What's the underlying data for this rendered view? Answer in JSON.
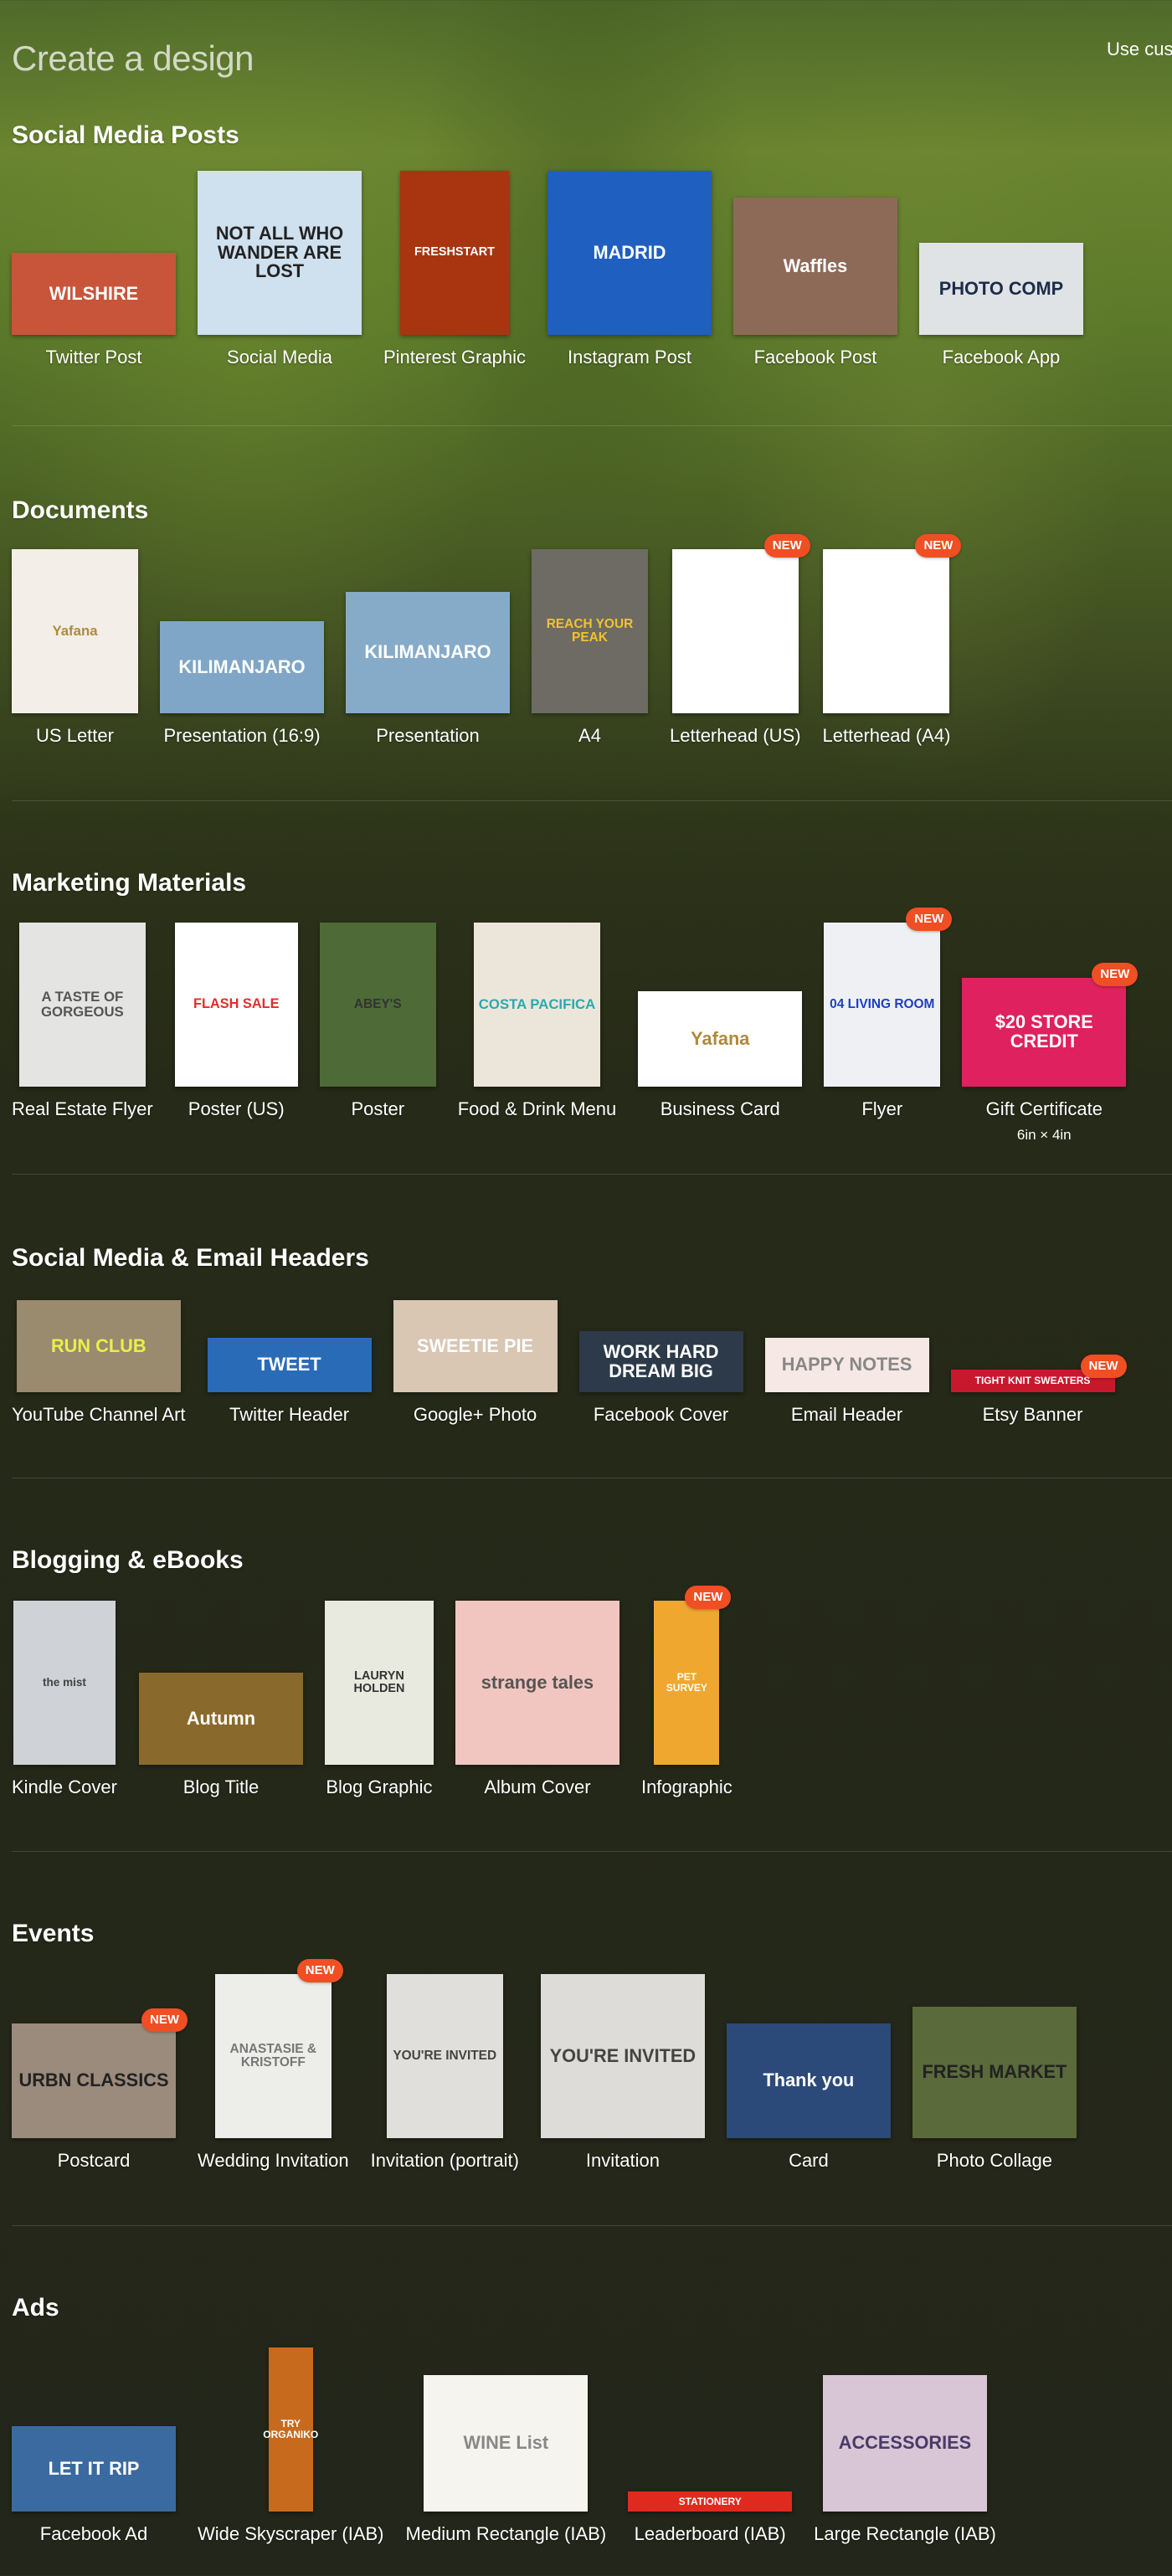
{
  "header": {
    "title": "Create a design",
    "custom_link": "Use cus"
  },
  "badge_label": "NEW",
  "sections": [
    {
      "title": "Social Media Posts",
      "items": [
        {
          "label": "Twitter Post",
          "thumb": "WILSHIRE",
          "bg": "#c8553a",
          "fg": "#fff"
        },
        {
          "label": "Social Media",
          "thumb": "NOT ALL WHO WANDER ARE LOST",
          "bg": "#cfe0ee",
          "fg": "#222"
        },
        {
          "label": "Pinterest Graphic",
          "thumb": "FRESHSTART",
          "bg": "#a8350f",
          "fg": "#fff"
        },
        {
          "label": "Instagram Post",
          "thumb": "MADRID",
          "bg": "#1f5fc0",
          "fg": "#fff"
        },
        {
          "label": "Facebook Post",
          "thumb": "Waffles",
          "bg": "#8d6a58",
          "fg": "#fff"
        },
        {
          "label": "Facebook App",
          "thumb": "PHOTO COMP",
          "bg": "#dfe3e6",
          "fg": "#1d2b4a"
        }
      ]
    },
    {
      "title": "Documents",
      "items": [
        {
          "label": "US Letter",
          "thumb": "Yafana",
          "bg": "#f3efe8",
          "fg": "#b08a3a"
        },
        {
          "label": "Presentation (16:9)",
          "thumb": "KILIMANJARO",
          "bg": "#7fa6c6",
          "fg": "#fff"
        },
        {
          "label": "Presentation",
          "thumb": "KILIMANJARO",
          "bg": "#86abc9",
          "fg": "#fff"
        },
        {
          "label": "A4",
          "thumb": "REACH YOUR PEAK",
          "bg": "#6d6b63",
          "fg": "#f2c230"
        },
        {
          "label": "Letterhead (US)",
          "thumb": "",
          "bg": "#ffffff",
          "fg": "#333",
          "new": true
        },
        {
          "label": "Letterhead (A4)",
          "thumb": "",
          "bg": "#ffffff",
          "fg": "#333",
          "new": true
        }
      ]
    },
    {
      "title": "Marketing Materials",
      "items": [
        {
          "label": "Real Estate Flyer",
          "thumb": "A TASTE OF GORGEOUS",
          "bg": "#e4e4e2",
          "fg": "#555"
        },
        {
          "label": "Poster (US)",
          "thumb": "FLASH SALE",
          "bg": "#ffffff",
          "fg": "#e52b2b"
        },
        {
          "label": "Poster",
          "thumb": "ABEY'S",
          "bg": "#4e6a36",
          "fg": "#333"
        },
        {
          "label": "Food & Drink Menu",
          "thumb": "COSTA PACIFICA",
          "bg": "#ece6da",
          "fg": "#2aa9b0"
        },
        {
          "label": "Business Card",
          "thumb": "Yafana",
          "bg": "#ffffff",
          "fg": "#b08a3a"
        },
        {
          "label": "Flyer",
          "thumb": "04 LIVING ROOM",
          "bg": "#eef0f4",
          "fg": "#1e3fbf",
          "new": true
        },
        {
          "label": "Gift Certificate",
          "sublabel": "6in × 4in",
          "thumb": "$20 STORE CREDIT",
          "bg": "#e0215f",
          "fg": "#fff",
          "new": true
        }
      ]
    },
    {
      "title": "Social Media & Email Headers",
      "items": [
        {
          "label": "YouTube Channel Art",
          "thumb": "RUN CLUB",
          "bg": "#9a8a6e",
          "fg": "#e8f04a"
        },
        {
          "label": "Twitter Header",
          "thumb": "TWEET",
          "bg": "#2a6bb8",
          "fg": "#fff"
        },
        {
          "label": "Google+ Photo",
          "thumb": "SWEETIE PIE",
          "bg": "#d9c6b3",
          "fg": "#fff"
        },
        {
          "label": "Facebook Cover",
          "thumb": "WORK HARD DREAM BIG",
          "bg": "#2c3a4a",
          "fg": "#fff"
        },
        {
          "label": "Email Header",
          "thumb": "HAPPY NOTES",
          "bg": "#f6e8e4",
          "fg": "#888"
        },
        {
          "label": "Etsy Banner",
          "thumb": "TIGHT KNIT SWEATERS",
          "bg": "#c8182e",
          "fg": "#fff",
          "new": true
        }
      ]
    },
    {
      "title": "Blogging & eBooks",
      "items": [
        {
          "label": "Kindle Cover",
          "thumb": "the mist",
          "bg": "#cfd2d6",
          "fg": "#444"
        },
        {
          "label": "Blog Title",
          "thumb": "Autumn",
          "bg": "#8a6a2c",
          "fg": "#fff"
        },
        {
          "label": "Blog Graphic",
          "thumb": "LAURYN HOLDEN",
          "bg": "#e9eadf",
          "fg": "#333"
        },
        {
          "label": "Album Cover",
          "thumb": "strange tales",
          "bg": "#f1c6c0",
          "fg": "#555"
        },
        {
          "label": "Infographic",
          "thumb": "PET SURVEY",
          "bg": "#f0a730",
          "fg": "#fff",
          "new": true
        }
      ]
    },
    {
      "title": "Events",
      "items": [
        {
          "label": "Postcard",
          "thumb": "URBN CLASSICS",
          "bg": "#9a8b7c",
          "fg": "#222",
          "new": true
        },
        {
          "label": "Wedding Invitation",
          "thumb": "ANASTASIE & KRISTOFF",
          "bg": "#ededea",
          "fg": "#777",
          "new": true
        },
        {
          "label": "Invitation (portrait)",
          "thumb": "YOU'RE INVITED",
          "bg": "#e0dfdb",
          "fg": "#444"
        },
        {
          "label": "Invitation",
          "thumb": "YOU'RE INVITED",
          "bg": "#dedcd8",
          "fg": "#444"
        },
        {
          "label": "Card",
          "thumb": "Thank you",
          "bg": "#2b4a7a",
          "fg": "#fff"
        },
        {
          "label": "Photo Collage",
          "thumb": "FRESH MARKET",
          "bg": "#5a6a3a",
          "fg": "#222"
        }
      ]
    },
    {
      "title": "Ads",
      "items": [
        {
          "label": "Facebook Ad",
          "thumb": "LET IT RIP",
          "bg": "#3a6aa0",
          "fg": "#fff"
        },
        {
          "label": "Wide Skyscraper (IAB)",
          "thumb": "TRY ORGANIKO",
          "bg": "#c86a1e",
          "fg": "#fff"
        },
        {
          "label": "Medium Rectangle (IAB)",
          "thumb": "WINE List",
          "bg": "#f6f4ee",
          "fg": "#888"
        },
        {
          "label": "Leaderboard (IAB)",
          "thumb": "STATIONERY",
          "bg": "#e02a1e",
          "fg": "#fff"
        },
        {
          "label": "Large Rectangle (IAB)",
          "thumb": "ACCESSORIES",
          "bg": "#d8c6d6",
          "fg": "#4a3a6a"
        }
      ]
    }
  ]
}
